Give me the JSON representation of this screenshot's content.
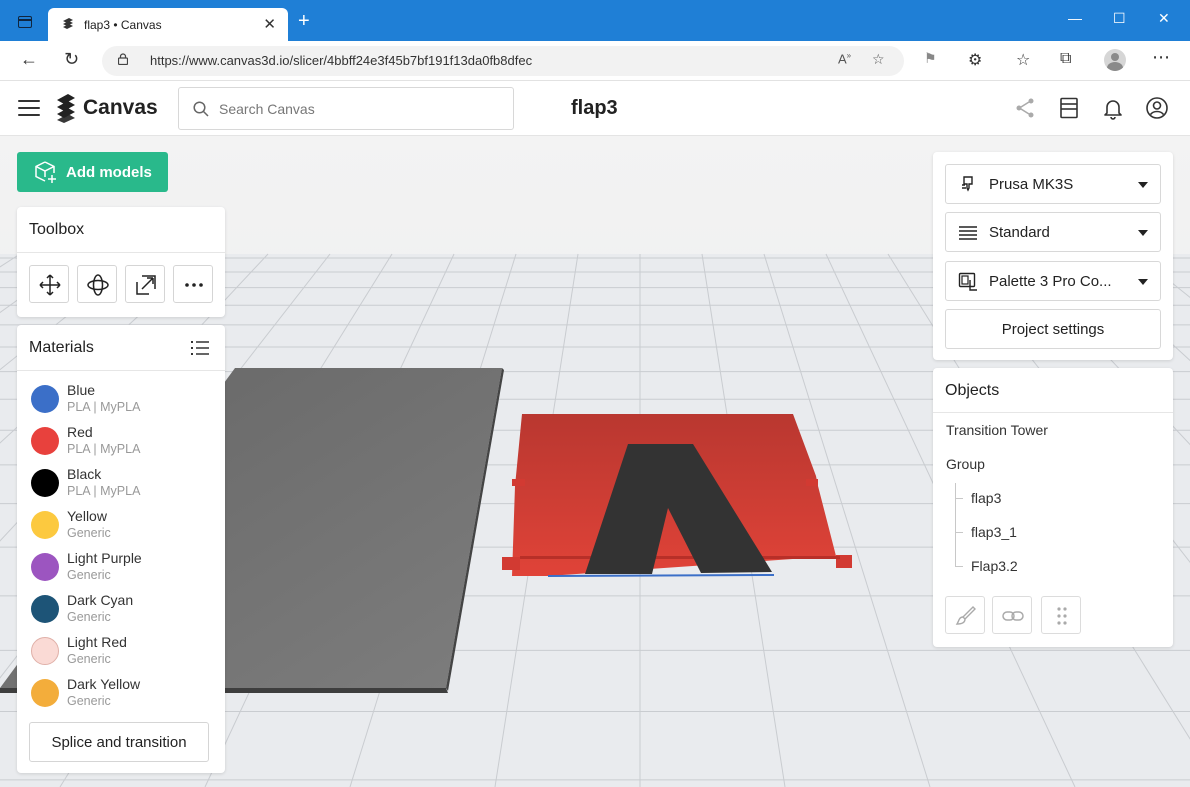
{
  "browser": {
    "tab_title": "flap3 • Canvas",
    "url": "https://www.canvas3d.io/slicer/4bbff24e3f45b7bf191f13da0fb8dfec",
    "new_tab_symbol": "+",
    "close_tab_symbol": "✕",
    "window_controls": {
      "minimize": "—",
      "maximize": "☐",
      "close": "✕"
    },
    "nav": {
      "back": "←",
      "reload": "↻"
    },
    "icons": [
      "read-aloud-icon",
      "favorite-add-icon",
      "extension-puzzle-icon",
      "favorites-icon",
      "collections-icon",
      "profile-icon",
      "more-icon"
    ]
  },
  "header": {
    "brand": "Canvas",
    "search_placeholder": "Search Canvas",
    "project_title": "flap3"
  },
  "left": {
    "add_models_label": "Add models",
    "toolbox_title": "Toolbox",
    "tools": [
      "move-tool",
      "rotate-tool",
      "scale-tool",
      "more-tool"
    ],
    "materials_title": "Materials",
    "materials": [
      {
        "name": "Blue",
        "sub": "PLA | MyPLA",
        "color": "#3b6fc8"
      },
      {
        "name": "Red",
        "sub": "PLA | MyPLA",
        "color": "#e8413d"
      },
      {
        "name": "Black",
        "sub": "PLA | MyPLA",
        "color": "#000000"
      },
      {
        "name": "Yellow",
        "sub": "Generic",
        "color": "#fcc93f"
      },
      {
        "name": "Light Purple",
        "sub": "Generic",
        "color": "#9c55c0"
      },
      {
        "name": "Dark Cyan",
        "sub": "Generic",
        "color": "#1d5477"
      },
      {
        "name": "Light Red",
        "sub": "Generic",
        "color": "#fadad5"
      },
      {
        "name": "Dark Yellow",
        "sub": "Generic",
        "color": "#f3ad3b"
      }
    ],
    "splice_label": "Splice and transition"
  },
  "right": {
    "printer": "Prusa MK3S",
    "profile": "Standard",
    "palette": "Palette 3 Pro Co...",
    "project_settings_label": "Project settings",
    "objects_title": "Objects",
    "objects": {
      "tower": "Transition Tower",
      "group": "Group",
      "children": [
        "flap3",
        "flap3_1",
        "Flap3.2"
      ]
    }
  }
}
